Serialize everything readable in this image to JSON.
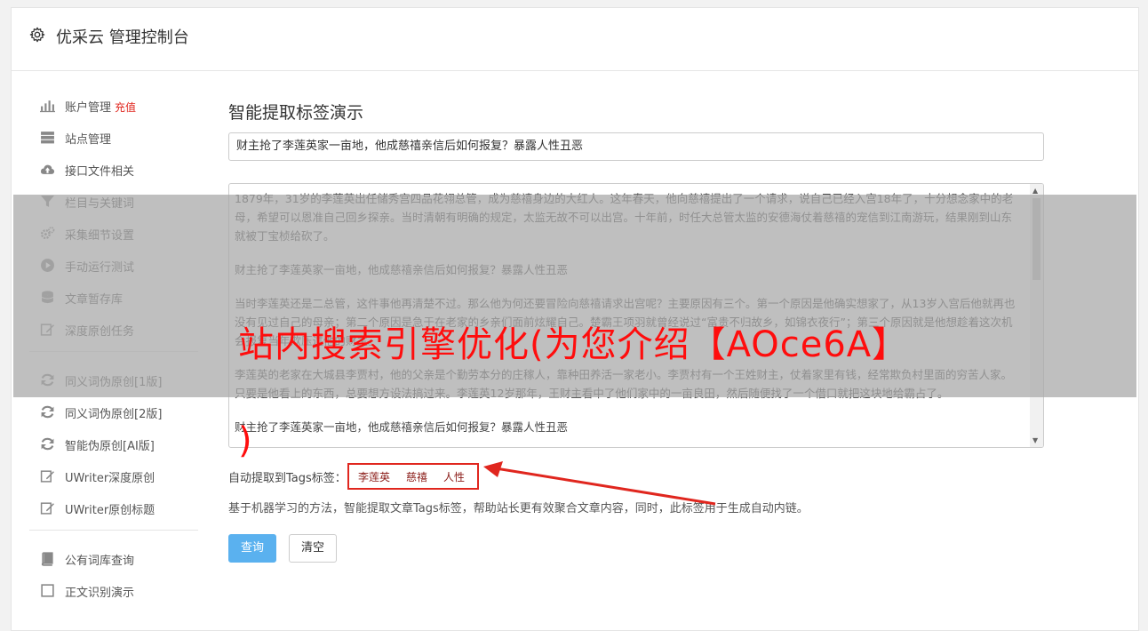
{
  "header": {
    "title": "优采云 管理控制台",
    "icon": "gear-icon"
  },
  "sidebar": {
    "groups": [
      [
        {
          "label": "账户管理",
          "extra": "充值",
          "icon": "bar-chart-icon"
        },
        {
          "label": "站点管理",
          "icon": "server-icon"
        },
        {
          "label": "接口文件相关",
          "icon": "cloud-upload-icon"
        },
        {
          "label": "栏目与关键词",
          "icon": "filter-icon"
        },
        {
          "label": "采集细节设置",
          "icon": "cogs-icon"
        },
        {
          "label": "手动运行测试",
          "icon": "play-circle-icon"
        },
        {
          "label": "文章暂存库",
          "icon": "database-icon"
        },
        {
          "label": "深度原创任务",
          "icon": "edit-icon"
        }
      ],
      [
        {
          "label": "同义词伪原创[1版]",
          "icon": "refresh-icon"
        },
        {
          "label": "同义词伪原创[2版]",
          "icon": "refresh-icon"
        },
        {
          "label": "智能伪原创[AI版]",
          "icon": "refresh-icon"
        },
        {
          "label": "UWriter深度原创",
          "icon": "edit-icon"
        },
        {
          "label": "UWriter原创标题",
          "icon": "edit-icon"
        }
      ],
      [
        {
          "label": "公有词库查询",
          "icon": "book-icon"
        },
        {
          "label": "正文识别演示",
          "icon": "square-icon"
        }
      ]
    ]
  },
  "main": {
    "heading": "智能提取标签演示",
    "title_value": "财主抢了李莲英家一亩地，他成慈禧亲信后如何报复？暴露人性丑恶",
    "content_paragraphs": [
      "1879年，31岁的李莲英出任储秀宫四品花翎总管，成为慈禧身边的大红人。这年春天，他向慈禧提出了一个请求，说自己已经入宫18年了，十分想念家中的老母，希望可以恩准自己回乡探亲。当时清朝有明确的规定，太监无故不可以出宫。十年前，时任大总管太监的安德海仗着慈禧的宠信到江南游玩，结果刚到山东就被丁宝桢给砍了。",
      "财主抢了李莲英家一亩地，他成慈禧亲信后如何报复？暴露人性丑恶",
      "当时李莲英还是二总管，这件事他再清楚不过。那么他为何还要冒险向慈禧请求出宫呢？主要原因有三个。第一个原因是他确实想家了，从13岁入宫后他就再也没有见过自己的母亲；第二个原因是急于在老家的乡亲们面前炫耀自己。楚霸王项羽就曾经说过“富贵不归故乡，如锦衣夜行”；第三个原因就是他想趁着这次机会报复当年欺压过他的财主。",
      "李莲英的老家在大城县李贾村，他的父亲是个勤劳本分的庄稼人，靠种田养活一家老小。李贾村有一个王姓财主，仗着家里有钱，经常欺负村里面的穷苦人家。只要是他看上的东西，总要想方设法搞过来。李莲英12岁那年，王财主看中了他们家中的一亩良田，然后随便找了一个借口就把这块地给霸占了。",
      "财主抢了李莲英家一亩地，他成慈禧亲信后如何报复？暴露人性丑恶"
    ],
    "tags_label": "自动提取到Tags标签：",
    "tags": [
      "李莲英",
      "慈禧",
      "人性"
    ],
    "description": "基于机器学习的方法，智能提取文章Tags标签，帮助站长更有效聚合文章内容，同时，此标签用于生成自动内链。",
    "query_button": "查询",
    "clear_button": "清空"
  },
  "overlay": {
    "text_line1": "站内搜索引擎优化(为您介绍【AOce6A】",
    "text_line2": ")",
    "text_color": "#ff0d0d",
    "arrow_color": "#e0261e"
  }
}
